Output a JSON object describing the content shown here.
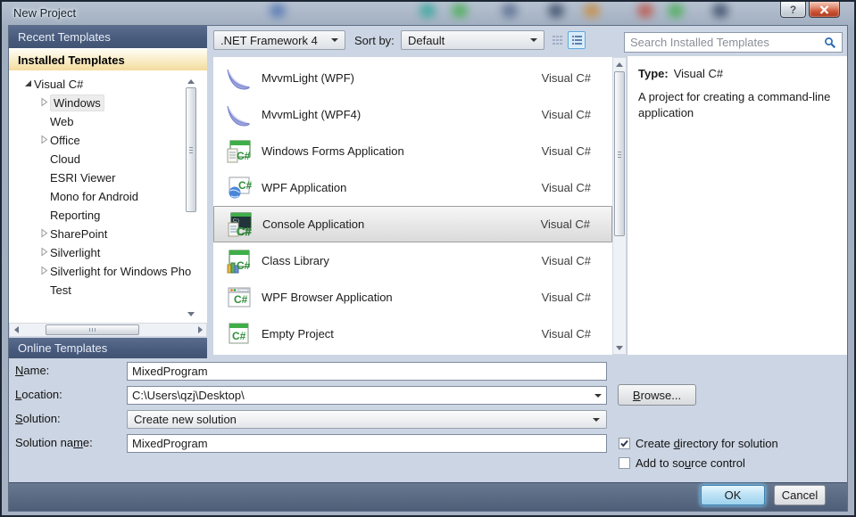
{
  "window": {
    "title": "New Project",
    "help_label": "?"
  },
  "sidebar": {
    "recent_header": "Recent Templates",
    "installed_header": "Installed Templates",
    "online_header": "Online Templates",
    "tree": [
      {
        "label": "Visual C#",
        "level": 0,
        "arrow": "expanded",
        "highlight": false
      },
      {
        "label": "Windows",
        "level": 1,
        "arrow": "collapsed",
        "highlight": true
      },
      {
        "label": "Web",
        "level": 1,
        "arrow": "none",
        "highlight": false
      },
      {
        "label": "Office",
        "level": 1,
        "arrow": "collapsed",
        "highlight": false
      },
      {
        "label": "Cloud",
        "level": 1,
        "arrow": "none",
        "highlight": false
      },
      {
        "label": "ESRI Viewer",
        "level": 1,
        "arrow": "none",
        "highlight": false
      },
      {
        "label": "Mono for Android",
        "level": 1,
        "arrow": "none",
        "highlight": false
      },
      {
        "label": "Reporting",
        "level": 1,
        "arrow": "none",
        "highlight": false
      },
      {
        "label": "SharePoint",
        "level": 1,
        "arrow": "collapsed",
        "highlight": false
      },
      {
        "label": "Silverlight",
        "level": 1,
        "arrow": "collapsed",
        "highlight": false
      },
      {
        "label": "Silverlight for Windows Pho",
        "level": 1,
        "arrow": "collapsed",
        "highlight": false
      },
      {
        "label": "Test",
        "level": 1,
        "arrow": "none",
        "highlight": false
      }
    ]
  },
  "toolbar": {
    "framework_value": ".NET Framework 4",
    "sortby_label": "Sort by:",
    "sort_value": "Default"
  },
  "search": {
    "placeholder": "Search Installed Templates"
  },
  "templates": {
    "items": [
      {
        "name": "MvvmLight (WPF)",
        "lang": "Visual C#",
        "icon": "mvvmlight-feather-icon",
        "selected": false
      },
      {
        "name": "MvvmLight (WPF4)",
        "lang": "Visual C#",
        "icon": "mvvmlight-feather-icon",
        "selected": false
      },
      {
        "name": "Windows Forms Application",
        "lang": "Visual C#",
        "icon": "winforms-app-icon",
        "selected": false
      },
      {
        "name": "WPF Application",
        "lang": "Visual C#",
        "icon": "wpf-app-icon",
        "selected": false
      },
      {
        "name": "Console Application",
        "lang": "Visual C#",
        "icon": "console-app-icon",
        "selected": true
      },
      {
        "name": "Class Library",
        "lang": "Visual C#",
        "icon": "class-library-icon",
        "selected": false
      },
      {
        "name": "WPF Browser Application",
        "lang": "Visual C#",
        "icon": "wpf-browser-app-icon",
        "selected": false
      },
      {
        "name": "Empty Project",
        "lang": "Visual C#",
        "icon": "empty-project-icon",
        "selected": false
      }
    ]
  },
  "info": {
    "type_label": "Type:",
    "type_value": "Visual C#",
    "description": "A project for creating a command-line application"
  },
  "form": {
    "name_label": {
      "text": "Name:",
      "mn": "N"
    },
    "name_value": "MixedProgram",
    "location_label": {
      "text": "Location:",
      "mn": "L"
    },
    "location_value": "C:\\Users\\qzj\\Desktop\\",
    "solution_label": {
      "text": "Solution:",
      "mn": "S"
    },
    "solution_value": "Create new solution",
    "solution_name_label": {
      "text": "Solution name:",
      "mn": "m"
    },
    "solution_name_value": "MixedProgram",
    "browse_label": {
      "text": "Browse...",
      "mn": "B"
    },
    "create_dir": {
      "text": "Create directory for solution",
      "mn": "d",
      "checked": true
    },
    "add_source": {
      "text": "Add to source control",
      "mn": "u",
      "checked": false
    }
  },
  "footer": {
    "ok_label": "OK",
    "cancel_label": "Cancel"
  },
  "colors": {
    "header_blue": "#47597b",
    "selected_gold": "#f3db9d",
    "accent_blue": "#3c7fb1",
    "close_red": "#d05a3c"
  }
}
